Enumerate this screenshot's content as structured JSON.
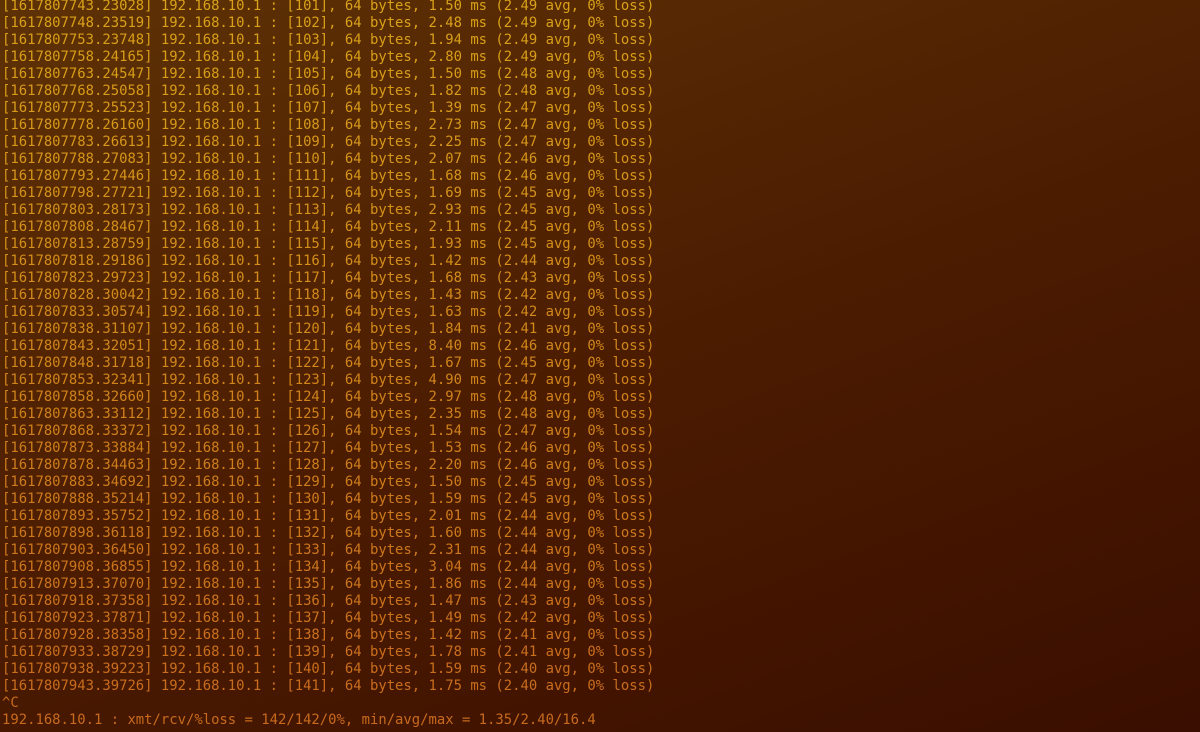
{
  "terminal": {
    "lines": [
      "[1617807743.23028] 192.168.10.1 : [101], 64 bytes, 1.50 ms (2.49 avg, 0% loss)",
      "[1617807748.23519] 192.168.10.1 : [102], 64 bytes, 2.48 ms (2.49 avg, 0% loss)",
      "[1617807753.23748] 192.168.10.1 : [103], 64 bytes, 1.94 ms (2.49 avg, 0% loss)",
      "[1617807758.24165] 192.168.10.1 : [104], 64 bytes, 2.80 ms (2.49 avg, 0% loss)",
      "[1617807763.24547] 192.168.10.1 : [105], 64 bytes, 1.50 ms (2.48 avg, 0% loss)",
      "[1617807768.25058] 192.168.10.1 : [106], 64 bytes, 1.82 ms (2.48 avg, 0% loss)",
      "[1617807773.25523] 192.168.10.1 : [107], 64 bytes, 1.39 ms (2.47 avg, 0% loss)",
      "[1617807778.26160] 192.168.10.1 : [108], 64 bytes, 2.73 ms (2.47 avg, 0% loss)",
      "[1617807783.26613] 192.168.10.1 : [109], 64 bytes, 2.25 ms (2.47 avg, 0% loss)",
      "[1617807788.27083] 192.168.10.1 : [110], 64 bytes, 2.07 ms (2.46 avg, 0% loss)",
      "[1617807793.27446] 192.168.10.1 : [111], 64 bytes, 1.68 ms (2.46 avg, 0% loss)",
      "[1617807798.27721] 192.168.10.1 : [112], 64 bytes, 1.69 ms (2.45 avg, 0% loss)",
      "[1617807803.28173] 192.168.10.1 : [113], 64 bytes, 2.93 ms (2.45 avg, 0% loss)",
      "[1617807808.28467] 192.168.10.1 : [114], 64 bytes, 2.11 ms (2.45 avg, 0% loss)",
      "[1617807813.28759] 192.168.10.1 : [115], 64 bytes, 1.93 ms (2.45 avg, 0% loss)",
      "[1617807818.29186] 192.168.10.1 : [116], 64 bytes, 1.42 ms (2.44 avg, 0% loss)",
      "[1617807823.29723] 192.168.10.1 : [117], 64 bytes, 1.68 ms (2.43 avg, 0% loss)",
      "[1617807828.30042] 192.168.10.1 : [118], 64 bytes, 1.43 ms (2.42 avg, 0% loss)",
      "[1617807833.30574] 192.168.10.1 : [119], 64 bytes, 1.63 ms (2.42 avg, 0% loss)",
      "[1617807838.31107] 192.168.10.1 : [120], 64 bytes, 1.84 ms (2.41 avg, 0% loss)",
      "[1617807843.32051] 192.168.10.1 : [121], 64 bytes, 8.40 ms (2.46 avg, 0% loss)",
      "[1617807848.31718] 192.168.10.1 : [122], 64 bytes, 1.67 ms (2.45 avg, 0% loss)",
      "[1617807853.32341] 192.168.10.1 : [123], 64 bytes, 4.90 ms (2.47 avg, 0% loss)",
      "[1617807858.32660] 192.168.10.1 : [124], 64 bytes, 2.97 ms (2.48 avg, 0% loss)",
      "[1617807863.33112] 192.168.10.1 : [125], 64 bytes, 2.35 ms (2.48 avg, 0% loss)",
      "[1617807868.33372] 192.168.10.1 : [126], 64 bytes, 1.54 ms (2.47 avg, 0% loss)",
      "[1617807873.33884] 192.168.10.1 : [127], 64 bytes, 1.53 ms (2.46 avg, 0% loss)",
      "[1617807878.34463] 192.168.10.1 : [128], 64 bytes, 2.20 ms (2.46 avg, 0% loss)",
      "[1617807883.34692] 192.168.10.1 : [129], 64 bytes, 1.50 ms (2.45 avg, 0% loss)",
      "[1617807888.35214] 192.168.10.1 : [130], 64 bytes, 1.59 ms (2.45 avg, 0% loss)",
      "[1617807893.35752] 192.168.10.1 : [131], 64 bytes, 2.01 ms (2.44 avg, 0% loss)",
      "[1617807898.36118] 192.168.10.1 : [132], 64 bytes, 1.60 ms (2.44 avg, 0% loss)",
      "[1617807903.36450] 192.168.10.1 : [133], 64 bytes, 2.31 ms (2.44 avg, 0% loss)",
      "[1617807908.36855] 192.168.10.1 : [134], 64 bytes, 3.04 ms (2.44 avg, 0% loss)",
      "[1617807913.37070] 192.168.10.1 : [135], 64 bytes, 1.86 ms (2.44 avg, 0% loss)",
      "[1617807918.37358] 192.168.10.1 : [136], 64 bytes, 1.47 ms (2.43 avg, 0% loss)",
      "[1617807923.37871] 192.168.10.1 : [137], 64 bytes, 1.49 ms (2.42 avg, 0% loss)",
      "[1617807928.38358] 192.168.10.1 : [138], 64 bytes, 1.42 ms (2.41 avg, 0% loss)",
      "[1617807933.38729] 192.168.10.1 : [139], 64 bytes, 1.78 ms (2.41 avg, 0% loss)",
      "[1617807938.39223] 192.168.10.1 : [140], 64 bytes, 1.59 ms (2.40 avg, 0% loss)",
      "[1617807943.39726] 192.168.10.1 : [141], 64 bytes, 1.75 ms (2.40 avg, 0% loss)",
      "^C",
      "192.168.10.1 : xmt/rcv/%loss = 142/142/0%, min/avg/max = 1.35/2.40/16.4"
    ]
  },
  "colors": {
    "background_top_left": "#5e3205",
    "background_bottom_right": "#3a0e00",
    "text_top": "#d9a21a",
    "text_bottom": "#c86a1e"
  }
}
